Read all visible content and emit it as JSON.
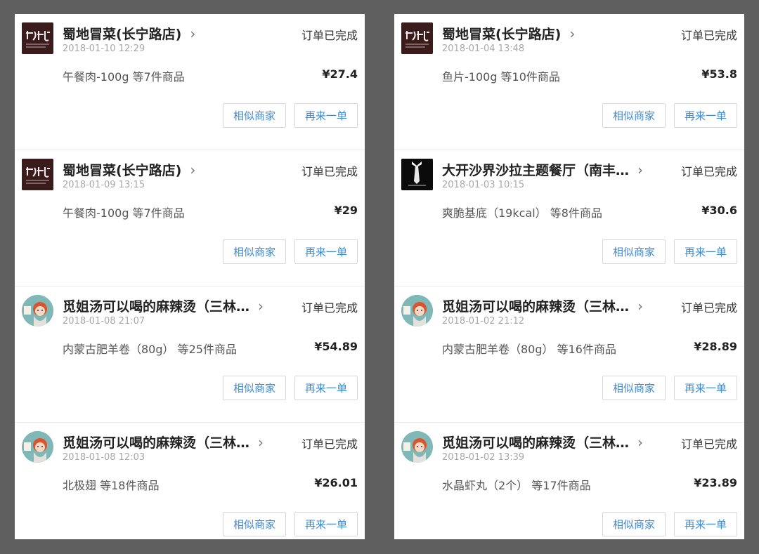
{
  "chevron": "›",
  "columns": [
    {
      "orders": [
        {
          "logo": "shudi-logo",
          "shop": "蜀地冒菜(长宁路店)",
          "status": "订单已完成",
          "time": "2018-01-10 12:29",
          "items": "午餐肉-100g 等7件商品",
          "price": "¥27.4",
          "btn_similar": "相似商家",
          "btn_again": "再来一单"
        },
        {
          "logo": "shudi-logo",
          "shop": "蜀地冒菜(长宁路店)",
          "status": "订单已完成",
          "time": "2018-01-09 13:15",
          "items": "午餐肉-100g 等7件商品",
          "price": "¥29",
          "btn_similar": "相似商家",
          "btn_again": "再来一单"
        },
        {
          "logo": "mijie-logo",
          "shop": "觅姐汤可以喝的麻辣烫（三林…",
          "status": "订单已完成",
          "time": "2018-01-08 21:07",
          "items": "内蒙古肥羊卷（80g） 等25件商品",
          "price": "¥54.89",
          "btn_similar": "相似商家",
          "btn_again": "再来一单"
        },
        {
          "logo": "mijie-logo",
          "shop": "觅姐汤可以喝的麻辣烫（三林…",
          "status": "订单已完成",
          "time": "2018-01-08 12:03",
          "items": "北极翅 等18件商品",
          "price": "¥26.01",
          "btn_similar": "相似商家",
          "btn_again": "再来一单"
        }
      ]
    },
    {
      "orders": [
        {
          "logo": "shudi-logo",
          "shop": "蜀地冒菜(长宁路店)",
          "status": "订单已完成",
          "time": "2018-01-04 13:48",
          "items": "鱼片-100g 等10件商品",
          "price": "¥53.8",
          "btn_similar": "相似商家",
          "btn_again": "再来一单"
        },
        {
          "logo": "dakaisha-logo",
          "shop": "大开沙界沙拉主题餐厅（南丰…",
          "status": "订单已完成",
          "time": "2018-01-03 10:15",
          "items": "爽脆基底（19kcal） 等8件商品",
          "price": "¥30.6",
          "btn_similar": "相似商家",
          "btn_again": "再来一单"
        },
        {
          "logo": "mijie-logo",
          "shop": "觅姐汤可以喝的麻辣烫（三林…",
          "status": "订单已完成",
          "time": "2018-01-02 21:12",
          "items": "内蒙古肥羊卷（80g） 等16件商品",
          "price": "¥28.89",
          "btn_similar": "相似商家",
          "btn_again": "再来一单"
        },
        {
          "logo": "mijie-logo",
          "shop": "觅姐汤可以喝的麻辣烫（三林…",
          "status": "订单已完成",
          "time": "2018-01-02 13:39",
          "items": "水晶虾丸（2个） 等17件商品",
          "price": "¥23.89",
          "btn_similar": "相似商家",
          "btn_again": "再来一单"
        }
      ]
    }
  ]
}
